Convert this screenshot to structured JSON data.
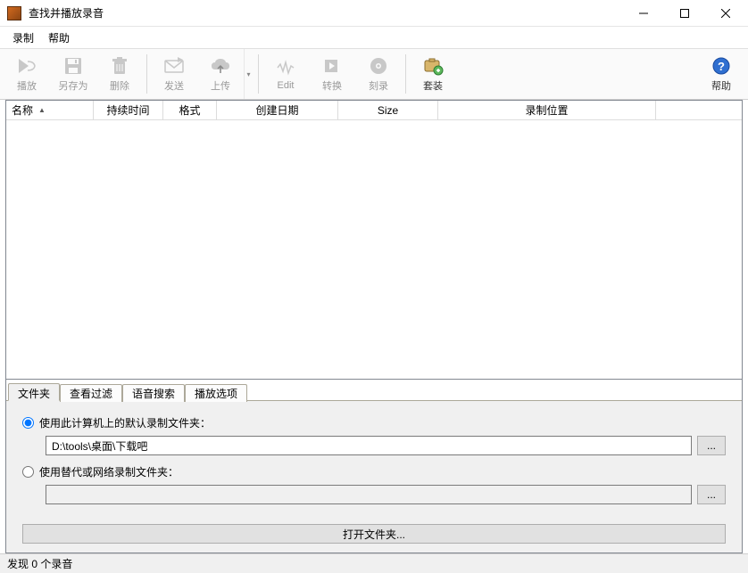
{
  "window": {
    "title": "查找并播放录音",
    "minimize": "−",
    "maximize": "□",
    "close": "×"
  },
  "menu": {
    "record": "录制",
    "help": "帮助"
  },
  "toolbar": {
    "play": "播放",
    "save_as": "另存为",
    "delete": "删除",
    "send": "发送",
    "upload": "上传",
    "edit": "Edit",
    "convert": "转换",
    "burn": "刻录",
    "suite": "套装",
    "help": "帮助"
  },
  "columns": {
    "name": "名称",
    "duration": "持续时间",
    "format": "格式",
    "created": "创建日期",
    "size": "Size",
    "location": "录制位置"
  },
  "tabs": {
    "folder": "文件夹",
    "filter": "查看过滤",
    "voice_search": "语音搜索",
    "play_options": "播放选项"
  },
  "folder_panel": {
    "use_default_label": "使用此计算机上的默认录制文件夹：",
    "default_path": "D:\\tools\\桌面\\下载吧",
    "use_alt_label": "使用替代或网络录制文件夹：",
    "alt_path": "",
    "browse": "...",
    "open_folder": "打开文件夹..."
  },
  "status": {
    "text": "发现 0 个录音"
  }
}
